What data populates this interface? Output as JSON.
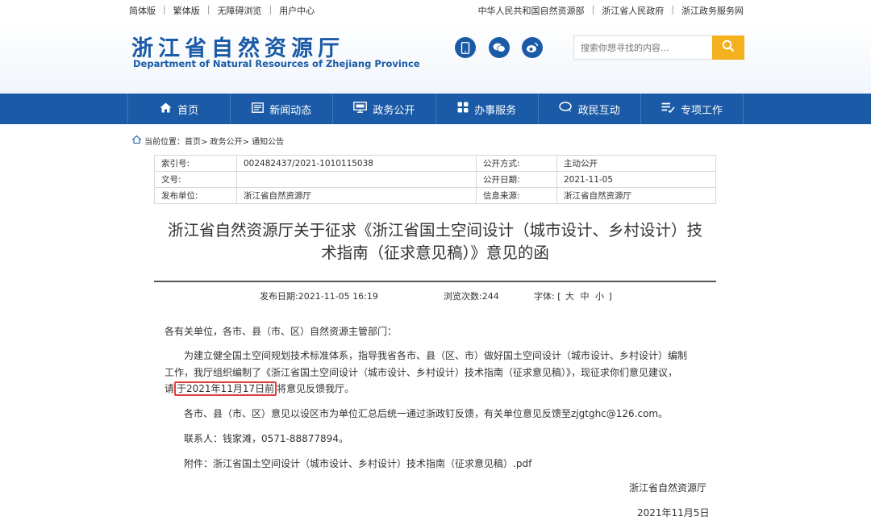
{
  "topbar": {
    "left_links": [
      "简体版",
      "繁体版",
      "无障碍浏览",
      "用户中心"
    ],
    "right_links": [
      "中华人民共和国自然资源部",
      "浙江省人民政府",
      "浙江政务服务网"
    ]
  },
  "header": {
    "logo_cn": "浙江省自然资源厅",
    "logo_en": "Department of Natural Resources of Zhejiang Province",
    "search_placeholder": "搜索你想寻找的内容...",
    "social_icons": [
      "mobile-icon",
      "wechat-icon",
      "weibo-icon"
    ]
  },
  "nav": {
    "items": [
      {
        "label": "首页",
        "icon": "home-icon"
      },
      {
        "label": "新闻动态",
        "icon": "news-icon"
      },
      {
        "label": "政务公开",
        "icon": "gov-icon"
      },
      {
        "label": "办事服务",
        "icon": "service-icon"
      },
      {
        "label": "政民互动",
        "icon": "chat-icon"
      },
      {
        "label": "专项工作",
        "icon": "list-icon"
      }
    ]
  },
  "breadcrumb": {
    "prefix": "当前位置：",
    "path": "首页> 政务公开> 通知公告"
  },
  "meta": {
    "index_label": "索引号:",
    "index_value": "002482437/2021-1010115038",
    "open_mode_label": "公开方式:",
    "open_mode_value": "主动公开",
    "doc_no_label": "文号:",
    "doc_no_value": "",
    "open_date_label": "公开日期:",
    "open_date_value": "2021-11-05",
    "issuer_label": "发布单位:",
    "issuer_value": "浙江省自然资源厅",
    "source_label": "信息来源:",
    "source_value": "浙江省自然资源厅"
  },
  "article": {
    "title_line1": "浙江省自然资源厅关于征求《浙江省国土空间设计（城市设计、乡村设计）技",
    "title_line2": "术指南（征求意见稿）》意见的函",
    "publish_date": "发布日期:2021-11-05 16:19",
    "views": "浏览次数:244",
    "font_label": "字体:",
    "font_open": "[",
    "font_large": "大",
    "font_medium": "中",
    "font_small": "小",
    "font_close": "]",
    "salutation": "各有关单位，各市、县（市、区）自然资源主管部门：",
    "p1_line1": "为建立健全国土空间规划技术标准体系，指导我省各市、县（区、市）做好国土空间设计（城市设计、乡村设计）编制",
    "p1_line2": "工作，我厅组织编制了《浙江省国土空间设计（城市设计、乡村设计）技术指南（征求意见稿）》，现征求你们意见建议，",
    "p1_line3_pre": "请",
    "p1_deadline": "于2021年11月17日前",
    "p1_line3_post": "将意见反馈我厅。",
    "p2": "各市、县（市、区）意见以设区市为单位汇总后统一通过浙政钉反馈，有关单位意见反馈至zjgtghc@126.com。",
    "contact": "联系人：钱家滩，0571-88877894。",
    "attachment_label": "附件：",
    "attachment_name": "浙江省国土空间设计（城市设计、乡村设计）技术指南（征求意见稿）.pdf",
    "signer": "浙江省自然资源厅",
    "sign_date": "2021年11月5日"
  },
  "colors": {
    "brand_blue": "#1a5aa6",
    "search_button": "#f4b11e",
    "highlight_box": "#e23b3b"
  }
}
